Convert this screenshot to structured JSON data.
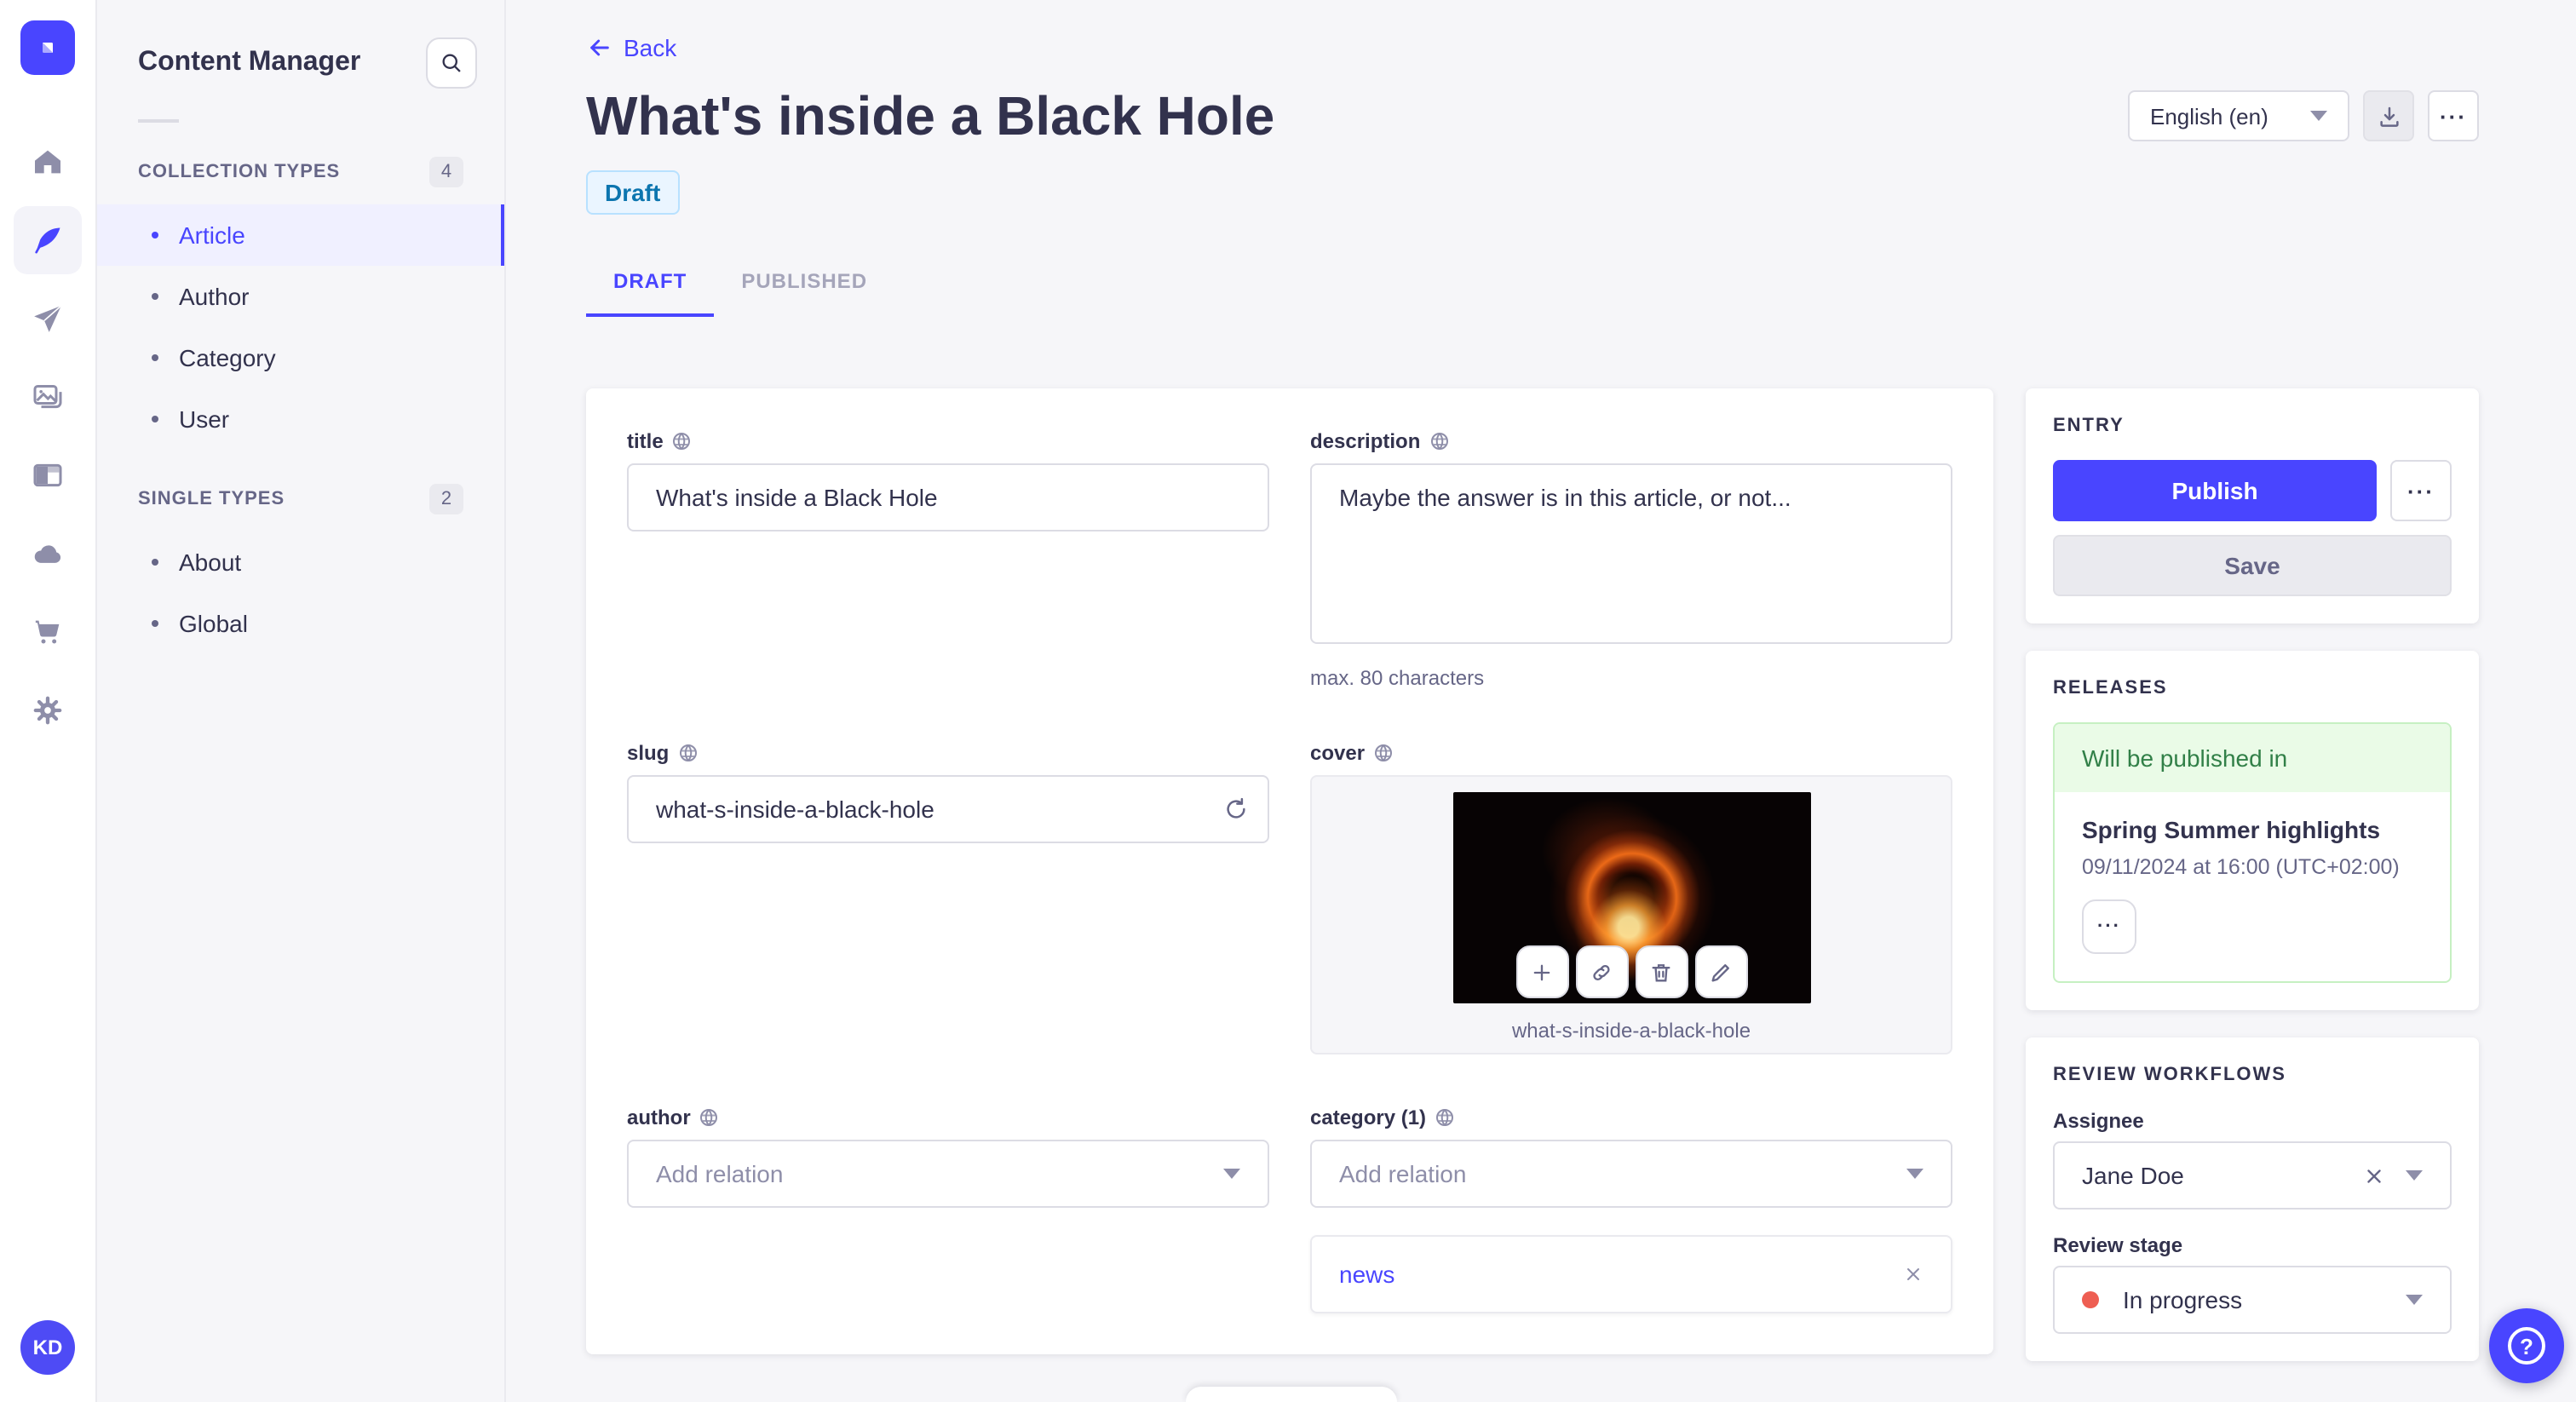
{
  "colors": {
    "primary": "#4945FF",
    "text": "#32324D",
    "text_muted": "#666687",
    "border": "#DCDCE4",
    "background": "#F6F6F9",
    "draft_badge_bg": "#EAF5FF",
    "draft_badge_text": "#0C75AF",
    "release_header_bg": "#EAFBE7",
    "release_text": "#328048",
    "stage_dot": "#EE5E52"
  },
  "rail": {
    "logo_icon": "strapi-logo",
    "items": [
      {
        "icon": "home-icon",
        "active": false
      },
      {
        "icon": "feather-icon",
        "active": true
      },
      {
        "icon": "paper-plane-icon",
        "active": false
      },
      {
        "icon": "media-library-icon",
        "active": false
      },
      {
        "icon": "layout-icon",
        "active": false
      },
      {
        "icon": "cloud-icon",
        "active": false
      },
      {
        "icon": "cart-icon",
        "active": false
      },
      {
        "icon": "gear-icon",
        "active": false
      }
    ]
  },
  "user": {
    "initials": "KD"
  },
  "subnav": {
    "title": "Content Manager",
    "sections": [
      {
        "label": "COLLECTION TYPES",
        "badge": "4",
        "items": [
          {
            "label": "Article",
            "active": true
          },
          {
            "label": "Author"
          },
          {
            "label": "Category"
          },
          {
            "label": "User"
          }
        ]
      },
      {
        "label": "SINGLE TYPES",
        "badge": "2",
        "items": [
          {
            "label": "About"
          },
          {
            "label": "Global"
          }
        ]
      }
    ]
  },
  "header": {
    "back_label": "Back",
    "title": "What's inside a Black Hole",
    "status_badge": "Draft",
    "locale": "English (en)",
    "more_label": "···"
  },
  "tabs": {
    "draft": "DRAFT",
    "published": "PUBLISHED"
  },
  "form": {
    "title": {
      "label": "title",
      "value": "What's inside a Black Hole"
    },
    "description": {
      "label": "description",
      "value": "Maybe the answer is in this article, or not...",
      "hint": "max. 80 characters"
    },
    "slug": {
      "label": "slug",
      "value": "what-s-inside-a-black-hole"
    },
    "cover": {
      "label": "cover",
      "filename": "what-s-inside-a-black-hole"
    },
    "author": {
      "label": "author",
      "placeholder": "Add relation"
    },
    "category": {
      "label": "category (1)",
      "placeholder": "Add relation",
      "relation": "news"
    }
  },
  "entry": {
    "title": "ENTRY",
    "publish_label": "Publish",
    "save_label": "Save",
    "more_label": "···"
  },
  "releases": {
    "title": "RELEASES",
    "status": "Will be published in",
    "name": "Spring Summer highlights",
    "datetime": "09/11/2024 at 16:00 (UTC+02:00)",
    "more_label": "···"
  },
  "review": {
    "title": "REVIEW WORKFLOWS",
    "assignee_label": "Assignee",
    "assignee_value": "Jane Doe",
    "stage_label": "Review stage",
    "stage_value": "In progress"
  },
  "help": {
    "label": "?"
  }
}
